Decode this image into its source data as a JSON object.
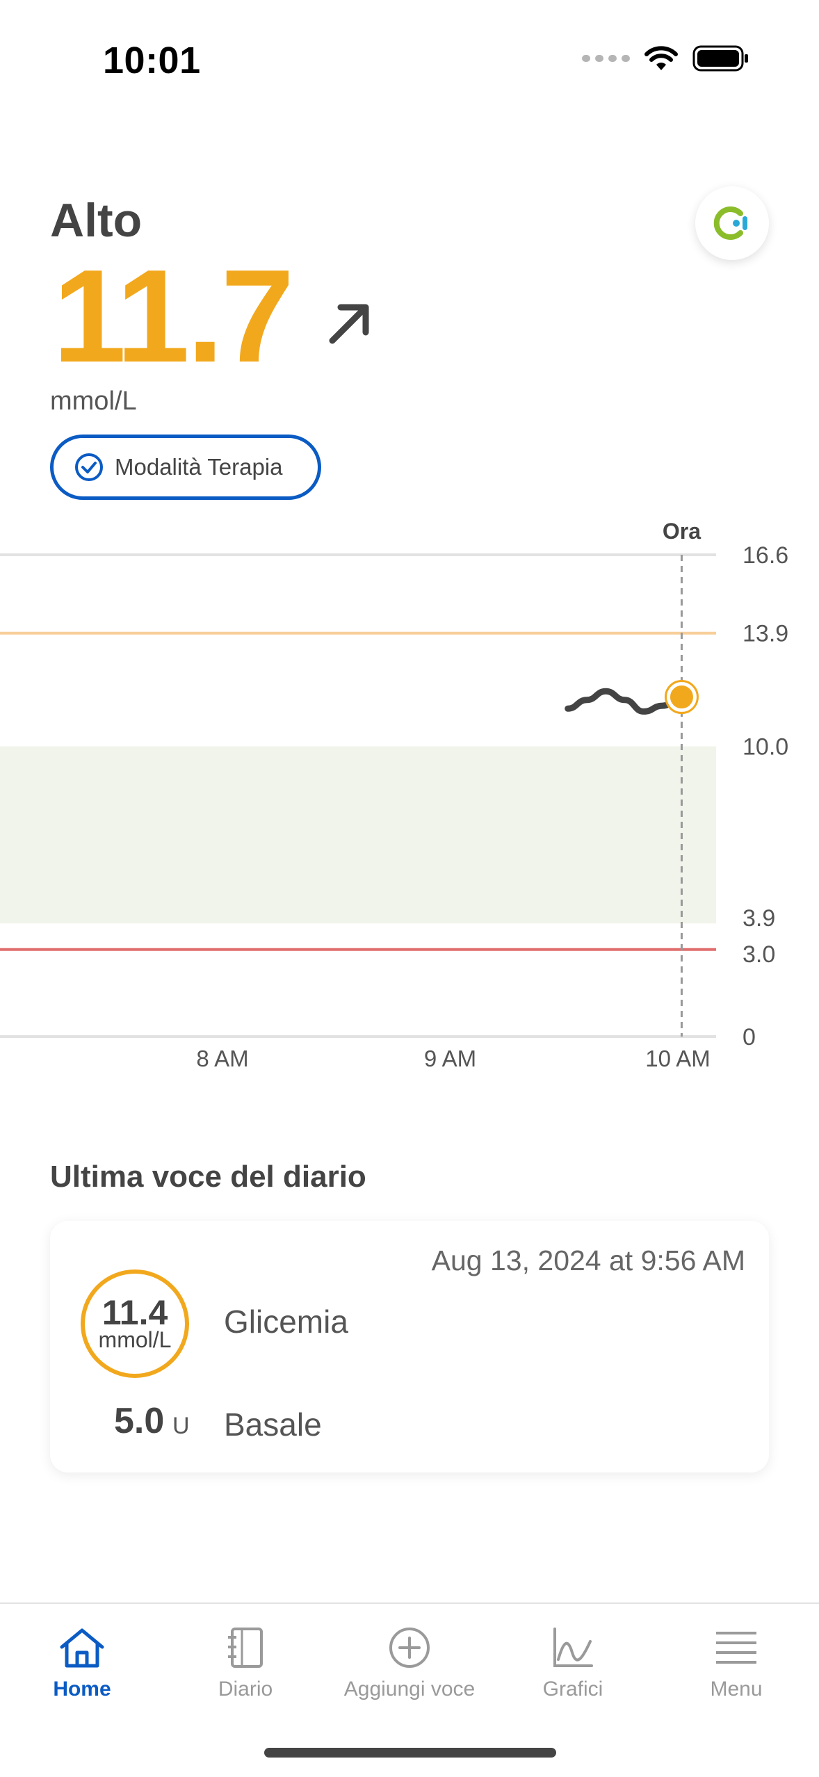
{
  "status_bar": {
    "time": "10:01"
  },
  "header": {
    "status_label": "Alto",
    "glucose_value": "11.7",
    "unit": "mmol/L",
    "trend": "rising-arrow-icon",
    "therapy_mode": "Modalità Terapia",
    "colors": {
      "high": "#f2a81d",
      "accent": "#0b5bc4"
    }
  },
  "chart_data": {
    "type": "line",
    "now_label": "Ora",
    "x_ticks": [
      "8 AM",
      "9 AM",
      "10 AM"
    ],
    "y_ticks": [
      "16.6",
      "13.9",
      "10.0",
      "3.9",
      "3.0",
      "0"
    ],
    "ylim": [
      0,
      16.6
    ],
    "target_range": [
      3.9,
      10.0
    ],
    "high_threshold": 13.9,
    "low_threshold": 3.0,
    "series": [
      {
        "x": [
          "9:31 AM",
          "9:36 AM",
          "9:41 AM",
          "9:46 AM",
          "9:51 AM",
          "9:56 AM",
          "10:01 AM"
        ],
        "values": [
          11.3,
          11.6,
          11.9,
          11.6,
          11.2,
          11.4,
          11.7
        ]
      }
    ]
  },
  "diary": {
    "title": "Ultima voce del diario",
    "date": "Aug 13, 2024 at 9:56 AM",
    "glucose_value": "11.4",
    "glucose_unit": "mmol/L",
    "glucose_label": "Glicemia",
    "basal_value": "5.0",
    "basal_unit": "U",
    "basal_label": "Basale"
  },
  "tabbar": {
    "home": "Home",
    "diary": "Diario",
    "add": "Aggiungi voce",
    "charts": "Grafici",
    "menu": "Menu"
  }
}
